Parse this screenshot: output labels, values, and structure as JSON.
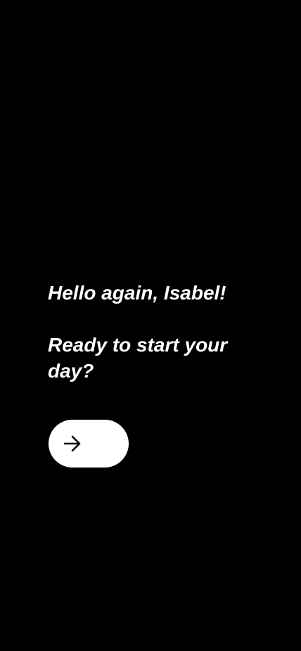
{
  "greeting": {
    "hello": "Hello again, Isabel!",
    "prompt_line1": "Ready to start your",
    "prompt_line2": "day?"
  },
  "action": {
    "icon": "arrow-right-icon"
  },
  "colors": {
    "background": "#000000",
    "text": "#ffffff",
    "button_bg": "#ffffff",
    "button_icon": "#000000"
  }
}
